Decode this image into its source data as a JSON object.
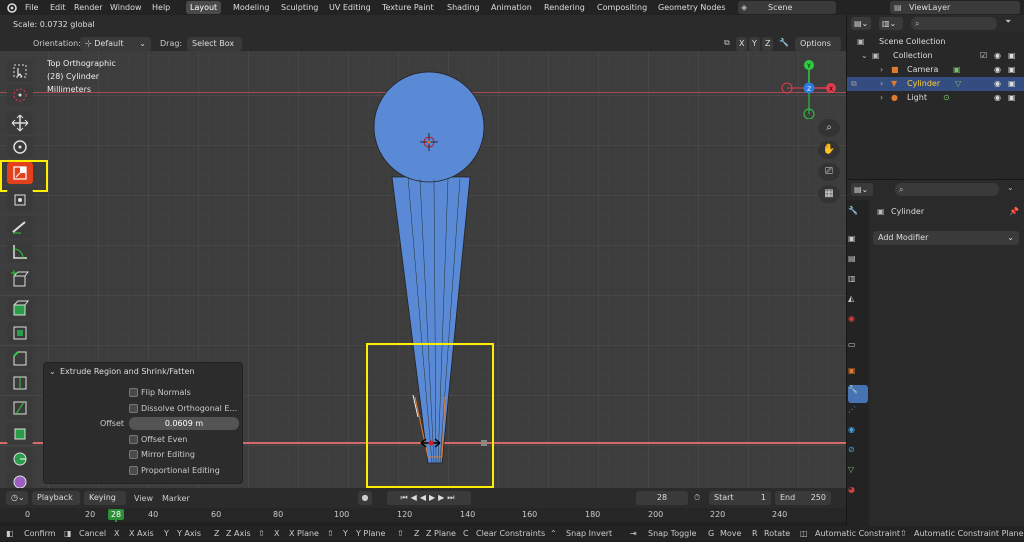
{
  "menus": [
    "File",
    "Edit",
    "Render",
    "Window",
    "Help"
  ],
  "workspaces": [
    "Layout",
    "Modeling",
    "Sculpting",
    "UV Editing",
    "Texture Paint",
    "Shading",
    "Animation",
    "Rendering",
    "Compositing",
    "Geometry Nodes"
  ],
  "scene_name": "Scene",
  "view_layer": "ViewLayer",
  "header": {
    "scale_text": "Scale: 0.0732 global",
    "orientation_label": "Orientation:",
    "orientation_value": "Default",
    "drag_label": "Drag:",
    "drag_value": "Select Box",
    "axes": [
      "X",
      "Y",
      "Z"
    ],
    "options_label": "Options"
  },
  "viewport": {
    "view_name": "Top Orthographic",
    "object_info": "(28) Cylinder",
    "units": "Millimeters",
    "gizmo_axes": [
      "X",
      "Y",
      "Z"
    ]
  },
  "operator_panel": {
    "title": "Extrude Region and Shrink/Fatten",
    "flip_normals": "Flip Normals",
    "dissolve_orthogonal": "Dissolve Orthogonal E...",
    "offset_label": "Offset",
    "offset_value": "0.0609 m",
    "offset_even": "Offset Even",
    "mirror_editing": "Mirror Editing",
    "proportional_editing": "Proportional Editing"
  },
  "timeline": {
    "playback": "Playback",
    "keying": "Keying",
    "view": "View",
    "marker": "Marker",
    "current_frame": "28",
    "start_label": "Start",
    "start_value": "1",
    "end_label": "End",
    "end_value": "250",
    "ruler_ticks": [
      "0",
      "20",
      "40",
      "60",
      "80",
      "100",
      "120",
      "140",
      "160",
      "180",
      "200",
      "220",
      "240"
    ],
    "ruler_current": "28"
  },
  "outliner": {
    "scene_collection": "Scene Collection",
    "collection": "Collection",
    "items": [
      "Camera",
      "Cylinder",
      "Light"
    ]
  },
  "properties": {
    "object_name": "Cylinder",
    "add_modifier": "Add Modifier"
  },
  "status": {
    "confirm": "Confirm",
    "cancel": "Cancel",
    "x_axis_key": "X",
    "x_axis": "X Axis",
    "y_axis_key": "Y",
    "y_axis": "Y Axis",
    "z_axis_key": "Z",
    "z_axis": "Z Axis",
    "x_plane_key": "X",
    "x_plane": "X Plane",
    "y_plane_key": "Y",
    "y_plane": "Y Plane",
    "z_plane_key": "Z",
    "z_plane": "Z Plane",
    "clear_key": "C",
    "clear_constraints": "Clear Constraints",
    "snap_invert": "Snap Invert",
    "snap_toggle": "Snap Toggle",
    "move_key": "G",
    "move": "Move",
    "rotate_key": "R",
    "rotate": "Rotate",
    "auto_constraint": "Automatic Constraint",
    "auto_constraint_plane": "Automatic Constraint Plane"
  },
  "colors": {
    "accent": "#4772b3",
    "mesh": "#5a8ad6",
    "highlight": "#ffee00",
    "active_tool": "#e2411c",
    "x_axis": "#e33b4e",
    "y_axis": "#2ecc40",
    "z_axis": "#2b7be0"
  }
}
